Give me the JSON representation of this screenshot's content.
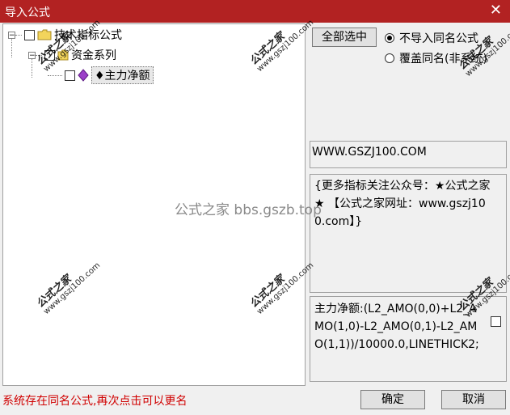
{
  "window": {
    "title": "导入公式",
    "close_glyph": "✕"
  },
  "tree": {
    "root_label": "技术指标公式",
    "child_label": "资金系列",
    "leaf_label": "♦主力净额"
  },
  "buttons": {
    "select_all": "全部选中",
    "ok": "确定",
    "cancel": "取消"
  },
  "radios": [
    {
      "label": "不导入同名公式",
      "checked": true
    },
    {
      "label": "覆盖同名(非系统)",
      "checked": false
    }
  ],
  "website_field": "WWW.GSZJ100.COM",
  "description": "{更多指标关注公众号：★公式之家★ 【公式之家网址：www.gszj100.com】}",
  "formula": "主力净额:(L2_AMO(0,0)+L2_AMO(1,0)-L2_AMO(0,1)-L2_AMO(1,1))/10000.0,LINETHICK2;",
  "status_message": "系统存在同名公式,再次点击可以更名",
  "watermark": {
    "stamp": "公式之家",
    "url": "www.gszj100.com",
    "center": "公式之家 bbs.gszb.top"
  }
}
